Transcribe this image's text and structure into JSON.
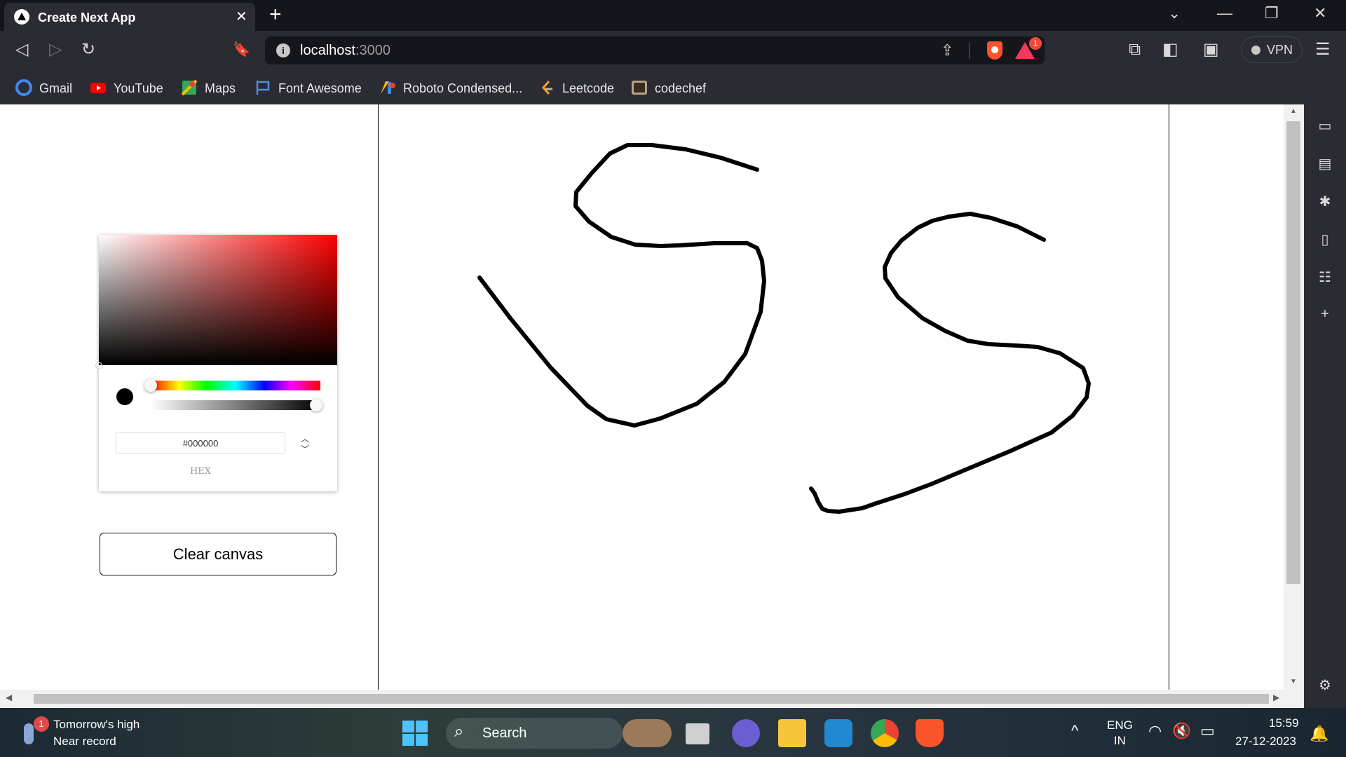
{
  "tab": {
    "title": "Create Next App",
    "close": "✕",
    "new_tab": "+"
  },
  "window_controls": {
    "tabsearch": "⌄",
    "minimize": "—",
    "restore": "❐",
    "close": "✕"
  },
  "toolbar": {
    "back": "◁",
    "forward": "▷",
    "reload": "↻",
    "bookmark": "🔖",
    "url_host": "localhost",
    "url_port": ":3000",
    "share": "⇪",
    "rewards_badge": "1",
    "extensions": "⧉",
    "sidebar_toggle": "◧",
    "wallet": "▣",
    "vpn_label": "VPN",
    "menu": "☰"
  },
  "bookmarks": [
    {
      "label": "Gmail",
      "icon": "google-icon",
      "color": "#4285f4"
    },
    {
      "label": "YouTube",
      "icon": "youtube-icon",
      "color": "#ff0000"
    },
    {
      "label": "Maps",
      "icon": "maps-icon",
      "color": "#34a853"
    },
    {
      "label": "Font Awesome",
      "icon": "flag-icon",
      "color": "#528dd7"
    },
    {
      "label": "Roboto Condensed...",
      "icon": "google-fonts-icon",
      "color": "#fbbc04"
    },
    {
      "label": "Leetcode",
      "icon": "leetcode-icon",
      "color": "#ffa116"
    },
    {
      "label": "codechef",
      "icon": "codechef-icon",
      "color": "#b8a28a"
    }
  ],
  "color_picker": {
    "hex_value": "#000000",
    "format_label": "HEX",
    "current_color": "#000000",
    "hue": 0,
    "alpha": 1
  },
  "clear_button": {
    "label": "Clear canvas"
  },
  "drawing": {
    "stroke_color": "#000000",
    "strokes": [
      "M144 247 L188 305 L246 376 L298 430 L325 449 L365 458 L402 448 L454 427 L493 396 L523 356 L545 296 L550 252 L547 223 L540 205 L526 198 L479 198 L431 201 L402 202 L366 200 L332 189 L300 167 L281 145 L282 125 L304 98 L330 70 L355 58 L390 58 L438 64 L488 76 L540 93",
      "M949 193 L911 174 L874 162 L844 156 L814 160 L790 166 L769 176 L746 194 L731 212 L722 232 L723 248 L741 275 L776 305 L808 323 L840 337 L870 342 L910 344 L940 346 L972 355 L1005 376 L1013 398 L1010 418 L990 444 L960 468 L900 495 L840 520 L790 541 L750 556 L710 569 L690 576 L657 581 L641 580 L633 577 L627 567 L622 555 L617 548"
    ]
  },
  "sidebar_icons": [
    "video-icon",
    "wallet-icon",
    "asterisk-icon",
    "bookmark-icon",
    "reading-list-icon",
    "plus-icon",
    "settings-icon"
  ],
  "taskbar": {
    "weather_badge": "1",
    "weather_title": "Tomorrow's high",
    "weather_sub": "Near record",
    "search_label": "Search",
    "lang_1": "ENG",
    "lang_2": "IN",
    "time": "15:59",
    "date": "27-12-2023"
  }
}
